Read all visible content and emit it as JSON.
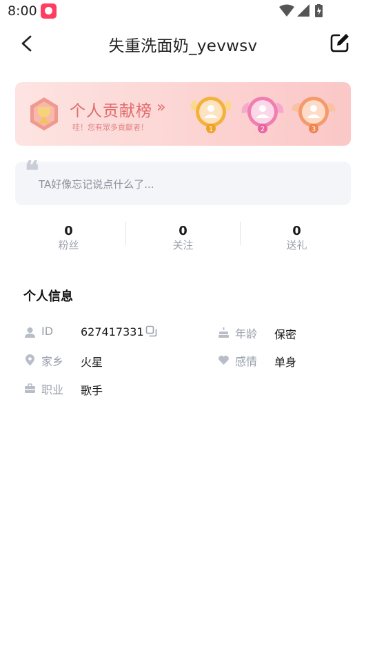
{
  "status_bar": {
    "time": "8:00",
    "icons": [
      "app-notification-icon",
      "wifi-icon",
      "signal-icon",
      "battery-charging-icon"
    ]
  },
  "header": {
    "title": "失重洗面奶_yevwsv",
    "back_icon": "chevron-left-icon",
    "edit_icon": "edit-icon"
  },
  "contribution_banner": {
    "title": "个人贡献榜",
    "arrow": "»",
    "subtitle": "哇！您有眾多貢獻者！",
    "medals": [
      {
        "rank": "1",
        "color": "#f5b13d"
      },
      {
        "rank": "2",
        "color": "#ef7fb0"
      },
      {
        "rank": "3",
        "color": "#f49a6c"
      }
    ]
  },
  "signature": {
    "quote_mark": "❝",
    "text": "TA好像忘记说点什么了..."
  },
  "stats": [
    {
      "value": "0",
      "label": "粉丝"
    },
    {
      "value": "0",
      "label": "关注"
    },
    {
      "value": "0",
      "label": "送礼"
    }
  ],
  "info": {
    "heading": "个人信息",
    "id": {
      "label": "ID",
      "value": "627417331",
      "icon": "user-icon",
      "copy_icon": "copy-icon"
    },
    "age": {
      "label": "年龄",
      "value": "保密",
      "icon": "cake-icon"
    },
    "hometown": {
      "label": "家乡",
      "value": "火星",
      "icon": "location-pin-icon"
    },
    "relationship": {
      "label": "感情",
      "value": "单身",
      "icon": "heart-icon"
    },
    "job": {
      "label": "职业",
      "value": "歌手",
      "icon": "briefcase-icon"
    }
  },
  "colors": {
    "banner_accent": "#e26b6b",
    "icon_gray": "#b8bdc8",
    "label_gray": "#9aa0ab"
  }
}
